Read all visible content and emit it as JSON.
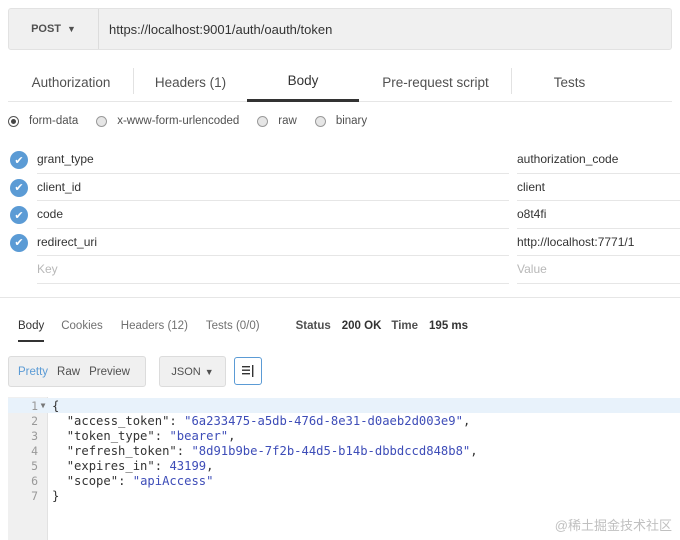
{
  "request": {
    "method": "POST",
    "url": "https://localhost:9001/auth/oauth/token"
  },
  "request_tabs": [
    {
      "label": "Authorization"
    },
    {
      "label": "Headers (1)"
    },
    {
      "label": "Body"
    },
    {
      "label": "Pre-request script"
    },
    {
      "label": "Tests"
    }
  ],
  "body_types": [
    {
      "label": "form-data",
      "selected": true
    },
    {
      "label": "x-www-form-urlencoded",
      "selected": false
    },
    {
      "label": "raw",
      "selected": false
    },
    {
      "label": "binary",
      "selected": false
    }
  ],
  "form_rows": [
    {
      "key": "grant_type",
      "value": "authorization_code"
    },
    {
      "key": "client_id",
      "value": "client"
    },
    {
      "key": "code",
      "value": "o8t4fi"
    },
    {
      "key": "redirect_uri",
      "value": "http://localhost:7771/1"
    }
  ],
  "form_placeholders": {
    "key": "Key",
    "value": "Value"
  },
  "response_tabs": [
    {
      "label": "Body"
    },
    {
      "label": "Cookies"
    },
    {
      "label": "Headers (12)"
    },
    {
      "label": "Tests (0/0)"
    }
  ],
  "status": {
    "label": "Status",
    "value": "200 OK",
    "time_label": "Time",
    "time_value": "195 ms"
  },
  "view_modes": [
    "Pretty",
    "Raw",
    "Preview"
  ],
  "format": "JSON",
  "code_lines": [
    {
      "n": "1",
      "text": "{"
    },
    {
      "n": "2",
      "key": "\"access_token\"",
      "val": "\"6a233475-a5db-476d-8e31-d0aeb2d003e9\"",
      "tail": ","
    },
    {
      "n": "3",
      "key": "\"token_type\"",
      "val": "\"bearer\"",
      "tail": ","
    },
    {
      "n": "4",
      "key": "\"refresh_token\"",
      "val": "\"8d91b9be-7f2b-44d5-b14b-dbbdccd848b8\"",
      "tail": ","
    },
    {
      "n": "5",
      "key": "\"expires_in\"",
      "val": "43199",
      "tail": ","
    },
    {
      "n": "6",
      "key": "\"scope\"",
      "val": "\"apiAccess\"",
      "tail": ""
    },
    {
      "n": "7",
      "text": "}"
    }
  ],
  "watermark": "@稀土掘金技术社区",
  "colors": {
    "accent": "#5b9bd5",
    "string": "#3e4db8"
  }
}
